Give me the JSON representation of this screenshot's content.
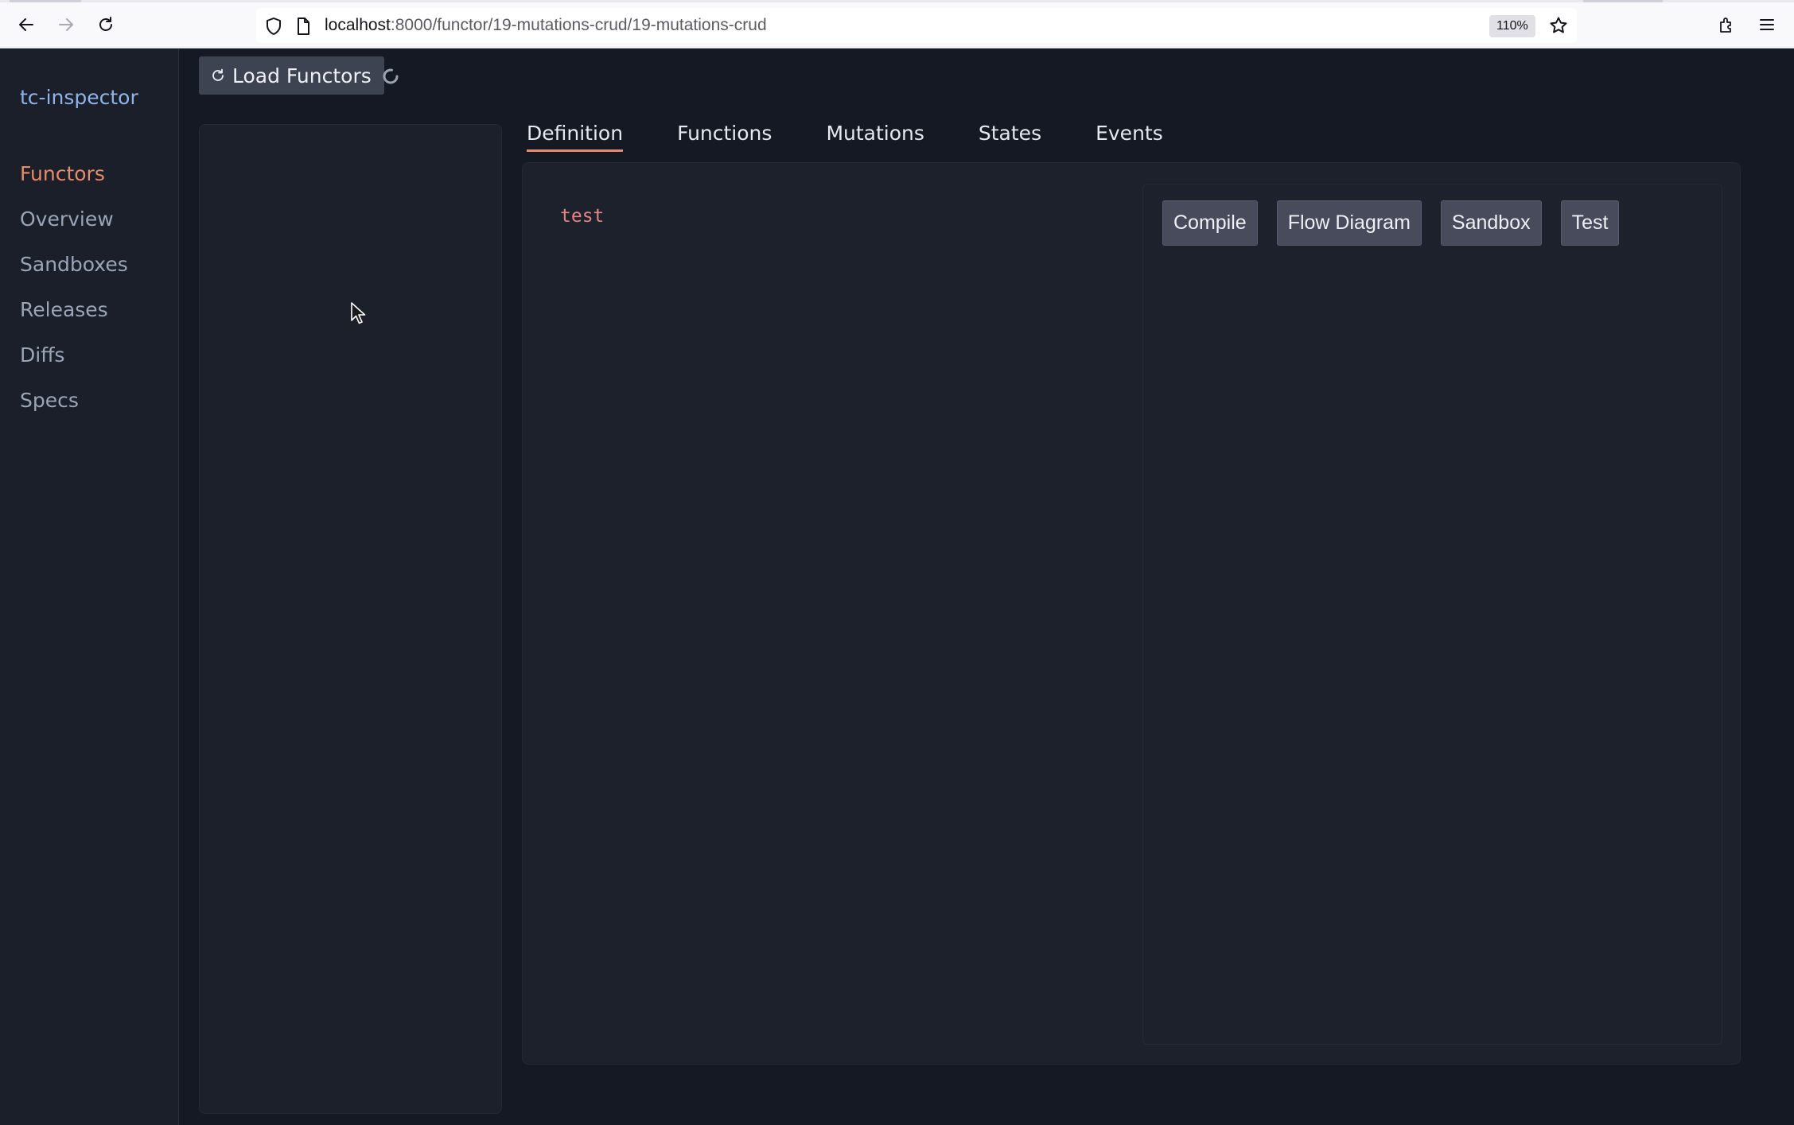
{
  "browser": {
    "url_host": "localhost",
    "url_path": ":8000/functor/19-mutations-crud/19-mutations-crud",
    "zoom": "110%",
    "icons": [
      "back-arrow-icon",
      "forward-arrow-icon",
      "reload-icon",
      "shield-icon",
      "page-icon",
      "star-icon",
      "extensions-icon",
      "menu-icon"
    ]
  },
  "sidebar": {
    "brand": "tc-inspector",
    "items": [
      {
        "label": "Functors",
        "active": true
      },
      {
        "label": "Overview"
      },
      {
        "label": "Sandboxes"
      },
      {
        "label": "Releases"
      },
      {
        "label": "Diffs"
      },
      {
        "label": "Specs"
      }
    ]
  },
  "toolbar": {
    "load_label": "Load Functors",
    "loading": true
  },
  "tabs": [
    {
      "label": "Definition",
      "active": true
    },
    {
      "label": "Functions"
    },
    {
      "label": "Mutations"
    },
    {
      "label": "States"
    },
    {
      "label": "Events"
    }
  ],
  "definition": {
    "code": "test"
  },
  "actions": {
    "compile": "Compile",
    "flow_diagram": "Flow Diagram",
    "sandbox": "Sandbox",
    "test": "Test"
  },
  "colors": {
    "accent": "#e88a6d",
    "brand": "#8fb4e8",
    "code": "#e78284",
    "background": "#141923"
  }
}
